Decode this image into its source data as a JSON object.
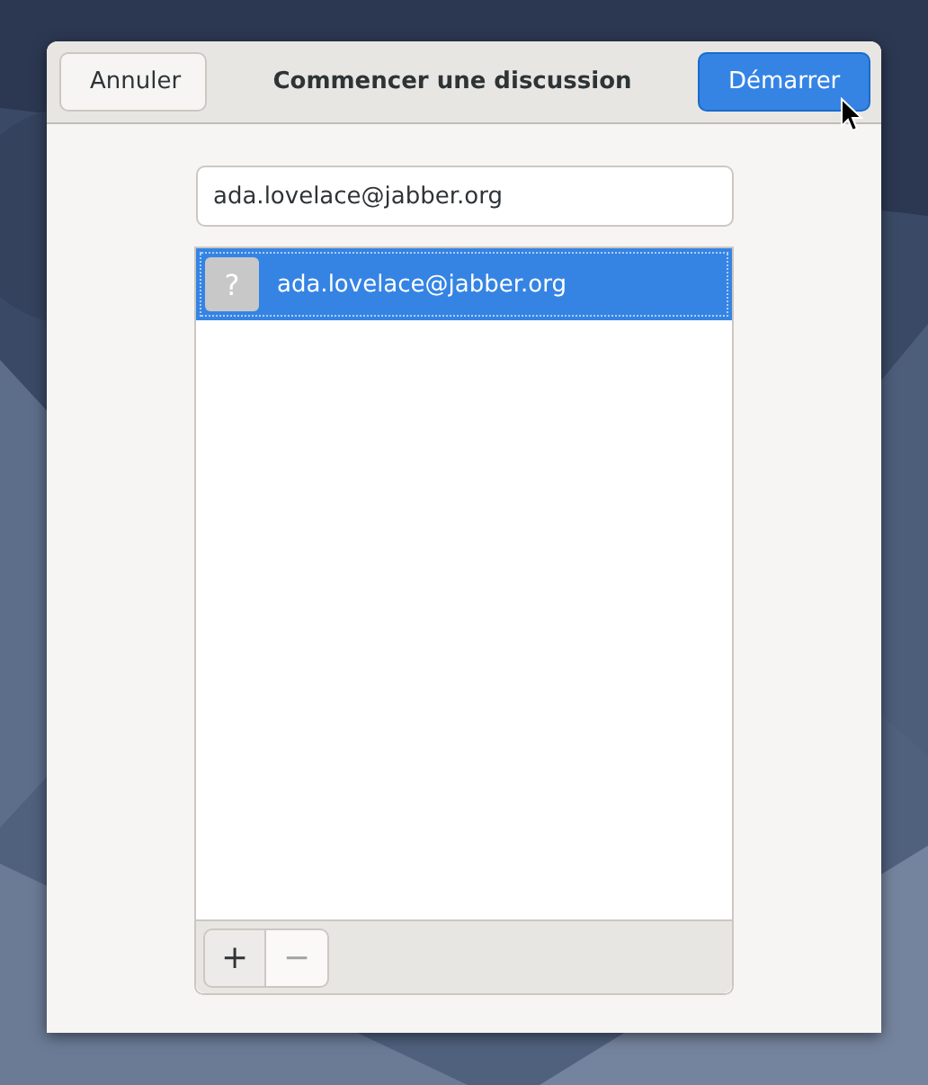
{
  "header": {
    "title": "Commencer une discussion",
    "cancel_button": "Annuler",
    "start_button": "Démarrer"
  },
  "search": {
    "value": "ada.lovelace@jabber.org"
  },
  "contacts": [
    {
      "avatar": "?",
      "address": "ada.lovelace@jabber.org",
      "selected": true
    }
  ],
  "toolbar": [
    {
      "label": "+",
      "disabled": false
    },
    {
      "label": "−",
      "disabled": true
    }
  ]
}
